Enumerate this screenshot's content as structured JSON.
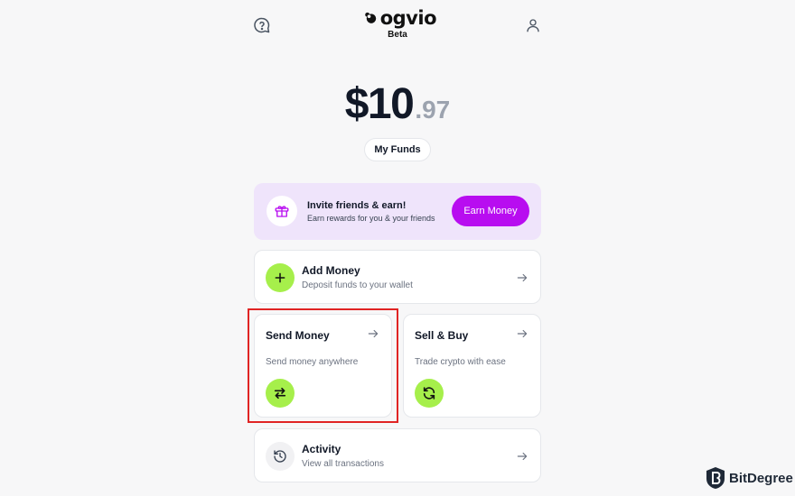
{
  "header": {
    "logo_text": "ogvio",
    "badge": "Beta"
  },
  "balance": {
    "whole": "$10",
    "cents": ".97"
  },
  "funds_button": "My Funds",
  "invite": {
    "title": "Invite friends & earn!",
    "subtitle": "Earn rewards for you & your friends",
    "button": "Earn Money"
  },
  "cards": {
    "add_money": {
      "title": "Add Money",
      "subtitle": "Deposit funds to your wallet"
    },
    "send_money": {
      "title": "Send Money",
      "subtitle": "Send money anywhere"
    },
    "sell_buy": {
      "title": "Sell & Buy",
      "subtitle": "Trade crypto with ease"
    },
    "activity": {
      "title": "Activity",
      "subtitle": "View all transactions"
    }
  },
  "watermark": {
    "text": "BitDegree"
  },
  "colors": {
    "accent_purple": "#b80df0",
    "accent_green": "#a6ef4b",
    "invite_bg": "#efe4fb",
    "highlight_red": "#e02424"
  }
}
